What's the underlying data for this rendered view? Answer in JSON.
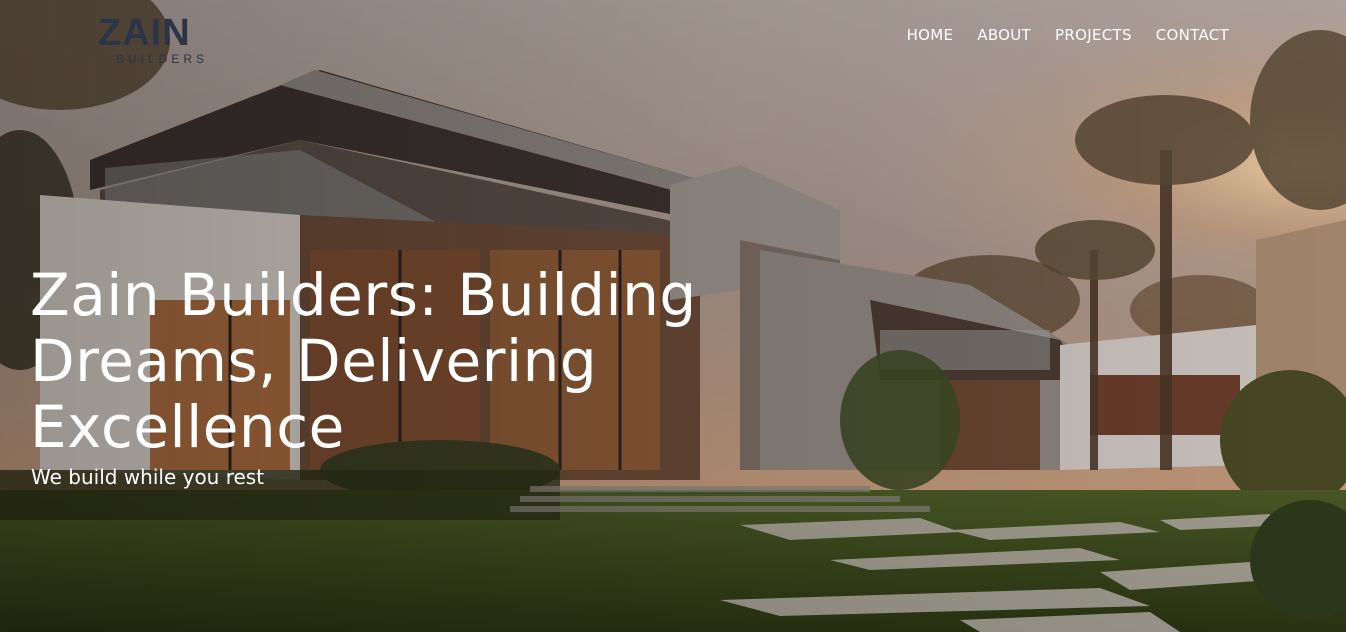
{
  "brand": {
    "logo_main": "ZAIN",
    "logo_sub": "BUILDERS"
  },
  "nav": {
    "items": [
      {
        "label": "HOME"
      },
      {
        "label": "ABOUT"
      },
      {
        "label": "PROJECTS"
      },
      {
        "label": "CONTACT"
      }
    ]
  },
  "hero": {
    "headline": "Zain Builders: Building Dreams, Delivering Excellence",
    "tagline": "We build while you rest",
    "background_image": "modern-house-at-sunset"
  },
  "colors": {
    "logo": "#2c3448",
    "text": "#ffffff"
  }
}
